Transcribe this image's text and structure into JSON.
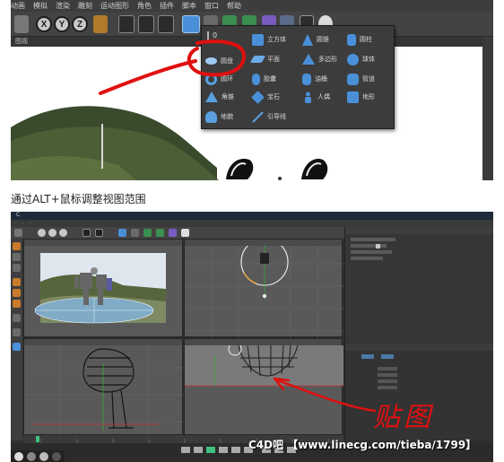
{
  "top_screenshot": {
    "menubar": [
      "动画",
      "模拟",
      "渲染",
      "雕刻",
      "运动图形",
      "角色",
      "插件",
      "脚本",
      "窗口",
      "帮助"
    ],
    "axis_buttons": [
      "X",
      "Y",
      "Z"
    ],
    "viewport_tab": "图视",
    "primitive_menu": {
      "items": [
        {
          "label": "圆盘",
          "color": "#9fc8f0"
        },
        {
          "label": "圆环",
          "color": "#5aa0e0"
        },
        {
          "label": "角锥",
          "color": "#5aa0e0"
        },
        {
          "label": "地貌",
          "color": "#5aa0e0"
        },
        {
          "label": "立方体",
          "color": "#4a90d9"
        },
        {
          "label": "平面",
          "color": "#6aaae6"
        },
        {
          "label": "胶囊",
          "color": "#4a90d9"
        },
        {
          "label": "宝石",
          "color": "#4a90d9"
        },
        {
          "label": "引导线",
          "color": "#5aa0e0"
        },
        {
          "label": "圆锥",
          "color": "#4a90d9"
        },
        {
          "label": "多边形",
          "color": "#4a90d9"
        },
        {
          "label": "油桶",
          "color": "#4a90d9"
        },
        {
          "label": "人偶",
          "color": "#4a90d9"
        },
        {
          "label": "圆柱",
          "color": "#4a90d9"
        },
        {
          "label": "球体",
          "color": "#4a90d9"
        },
        {
          "label": "管道",
          "color": "#4a90d9"
        },
        {
          "label": "地形",
          "color": "#4a90d9"
        }
      ]
    }
  },
  "caption": "通过ALT+鼠标调整视图范围",
  "bottom_screenshot": {
    "handwritten_note": "贴图",
    "watermark": "C4D吧 【www.linecg.com/tieba/1799】"
  },
  "colors": {
    "ui_dark": "#3c3c3c",
    "accent_blue": "#4a90d9",
    "annotation_red": "#e01010"
  }
}
